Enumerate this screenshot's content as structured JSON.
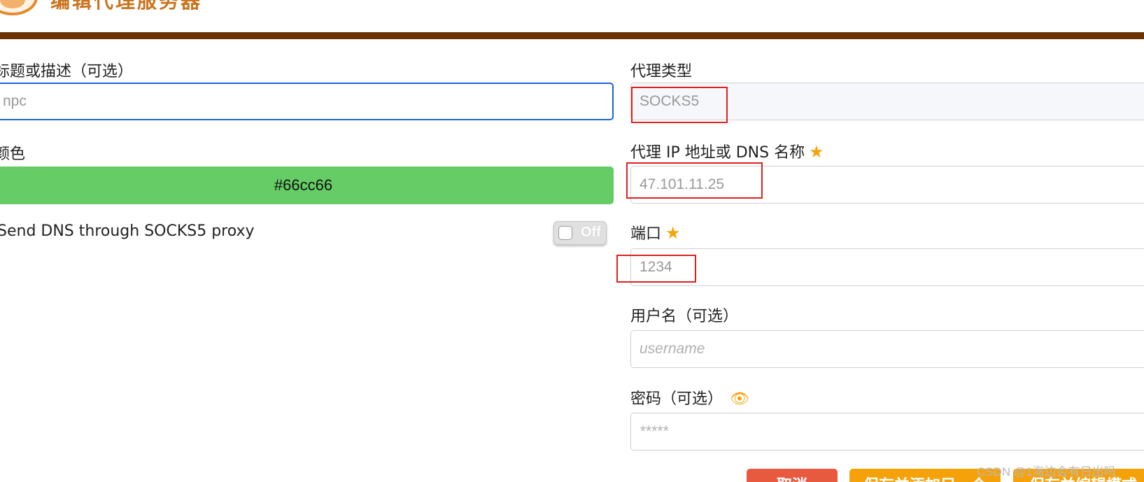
{
  "header": {
    "title": "编辑代理服务器"
  },
  "form": {
    "title_label": "标题或描述（可选）",
    "title_value": "npc",
    "color_label": "颜色",
    "color_value": "#66cc66",
    "send_dns_label": "Send DNS through SOCKS5 proxy",
    "send_dns_toggle": "Off",
    "proxy_type_label": "代理类型",
    "proxy_type_value": "SOCKS5",
    "proxy_host_label": "代理 IP 地址或 DNS 名称",
    "proxy_host_value": "47.101.11.25",
    "port_label": "端口",
    "port_value": "1234",
    "username_label": "用户名（可选）",
    "username_placeholder": "username",
    "password_label": "密码（可选）",
    "password_placeholder": "*****"
  },
  "buttons": {
    "cancel": "取消",
    "save_add": "保存并添加另一个",
    "save_edit": "保存并编辑模式"
  },
  "icons": {
    "required": "star-icon",
    "show_password": "eye-icon"
  },
  "colors": {
    "header_bar": "#6a3300",
    "accent": "#f5a20a",
    "focus": "#1a66d4",
    "highlight_box": "#e02020",
    "cancel": "#e85a3f"
  },
  "watermark": "CSDN @1海边会有日出吗"
}
